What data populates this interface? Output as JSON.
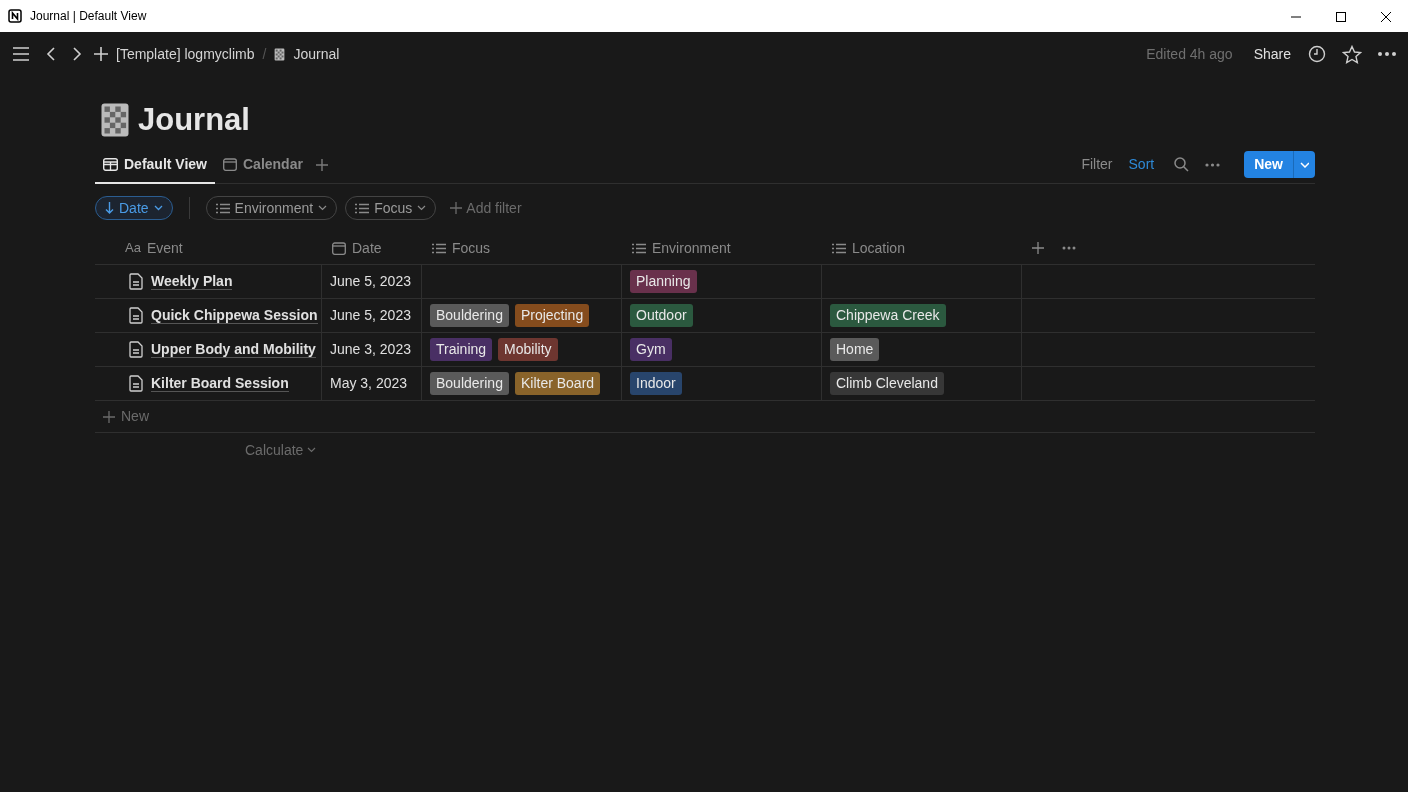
{
  "window": {
    "title": "Journal | Default View"
  },
  "topbar": {
    "breadcrumbs": [
      {
        "label": "[Template] logmyclimb",
        "kind": "text"
      },
      {
        "label": "Journal",
        "kind": "page"
      }
    ],
    "separator": "/",
    "edited": "Edited 4h ago",
    "share": "Share"
  },
  "page": {
    "title": "Journal"
  },
  "tabs": [
    {
      "label": "Default View",
      "kind": "table",
      "selected": true
    },
    {
      "label": "Calendar",
      "kind": "calendar",
      "selected": false
    }
  ],
  "actions": [
    {
      "label": "Filter",
      "active": false
    },
    {
      "label": "Sort",
      "active": true
    }
  ],
  "new_button": "New",
  "chips": [
    {
      "kind": "sort",
      "label": "Date"
    },
    {
      "kind": "filter",
      "label": "Environment"
    },
    {
      "kind": "filter",
      "label": "Focus"
    }
  ],
  "add_filter": "Add filter",
  "table": {
    "columns": [
      {
        "label": "Event",
        "kind": "title",
        "icon_text": "Aa"
      },
      {
        "label": "Date",
        "kind": "date"
      },
      {
        "label": "Focus",
        "kind": "list"
      },
      {
        "label": "Environment",
        "kind": "list"
      },
      {
        "label": "Location",
        "kind": "list"
      }
    ],
    "rows": [
      {
        "event": "Weekly Plan",
        "date": "June 5, 2023",
        "focus": [],
        "environment": [
          {
            "label": "Planning",
            "color": "#69314c"
          }
        ],
        "location": []
      },
      {
        "event": "Quick Chippewa Session",
        "date": "June 5, 2023",
        "focus": [
          {
            "label": "Bouldering",
            "color": "#5a5a5a"
          },
          {
            "label": "Projecting",
            "color": "#854c1d"
          }
        ],
        "environment": [
          {
            "label": "Outdoor",
            "color": "#2b593f"
          }
        ],
        "location": [
          {
            "label": "Chippewa Creek",
            "color": "#2b593f"
          }
        ]
      },
      {
        "event": "Upper Body and Mobility",
        "date": "June 3, 2023",
        "focus": [
          {
            "label": "Training",
            "color": "#492f64"
          },
          {
            "label": "Mobility",
            "color": "#6e3630"
          }
        ],
        "environment": [
          {
            "label": "Gym",
            "color": "#492f64"
          }
        ],
        "location": [
          {
            "label": "Home",
            "color": "#5a5a5a"
          }
        ]
      },
      {
        "event": "Kilter Board Session",
        "date": "May 3, 2023",
        "focus": [
          {
            "label": "Bouldering",
            "color": "#5a5a5a"
          },
          {
            "label": "Kilter Board",
            "color": "#89632a"
          }
        ],
        "environment": [
          {
            "label": "Indoor",
            "color": "#28456c"
          }
        ],
        "location": [
          {
            "label": "Climb Cleveland",
            "color": "#373737"
          }
        ]
      }
    ],
    "new_row": "New",
    "calculate": "Calculate"
  }
}
